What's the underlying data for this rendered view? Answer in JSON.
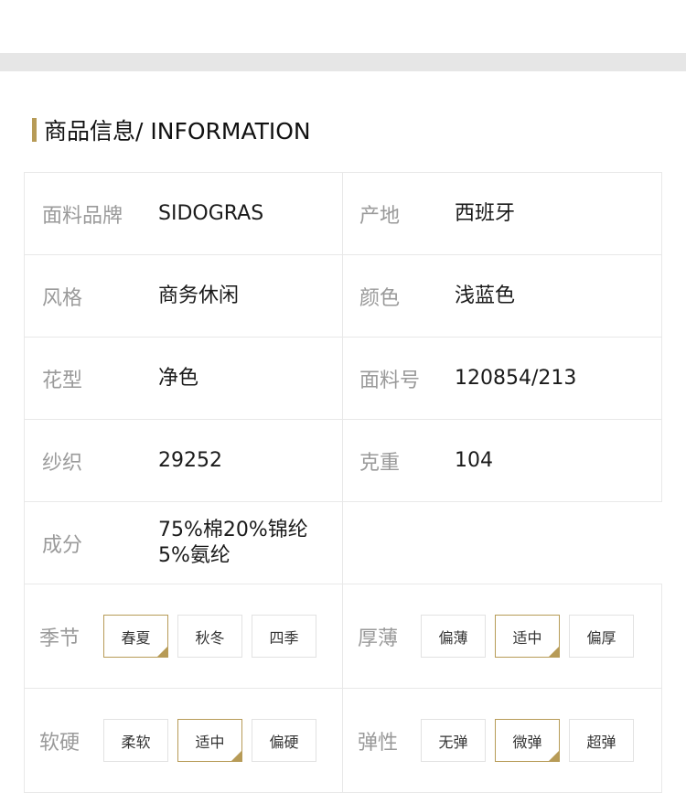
{
  "section": {
    "title": "商品信息/ INFORMATION",
    "accent_color": "#b79b57"
  },
  "info": {
    "fabric_brand": {
      "label": "面料品牌",
      "value": "SIDOGRAS"
    },
    "origin": {
      "label": "产地",
      "value": "西班牙"
    },
    "style": {
      "label": "风格",
      "value": "商务休闲"
    },
    "color": {
      "label": "颜色",
      "value": "浅蓝色"
    },
    "pattern": {
      "label": "花型",
      "value": "净色"
    },
    "fabric_no": {
      "label": "面料号",
      "value": "120854/213"
    },
    "yarn": {
      "label": "纱织",
      "value": "29252"
    },
    "weight": {
      "label": "克重",
      "value": "104"
    },
    "composition": {
      "label": "成分",
      "value": "75%棉20%锦纶\n5%氨纶"
    }
  },
  "options": {
    "season": {
      "label": "季节",
      "choices": [
        "春夏",
        "秋冬",
        "四季"
      ],
      "selected": "春夏"
    },
    "thickness": {
      "label": "厚薄",
      "choices": [
        "偏薄",
        "适中",
        "偏厚"
      ],
      "selected": "适中"
    },
    "softness": {
      "label": "软硬",
      "choices": [
        "柔软",
        "适中",
        "偏硬"
      ],
      "selected": "适中"
    },
    "elasticity": {
      "label": "弹性",
      "choices": [
        "无弹",
        "微弹",
        "超弹"
      ],
      "selected": "微弹"
    }
  }
}
